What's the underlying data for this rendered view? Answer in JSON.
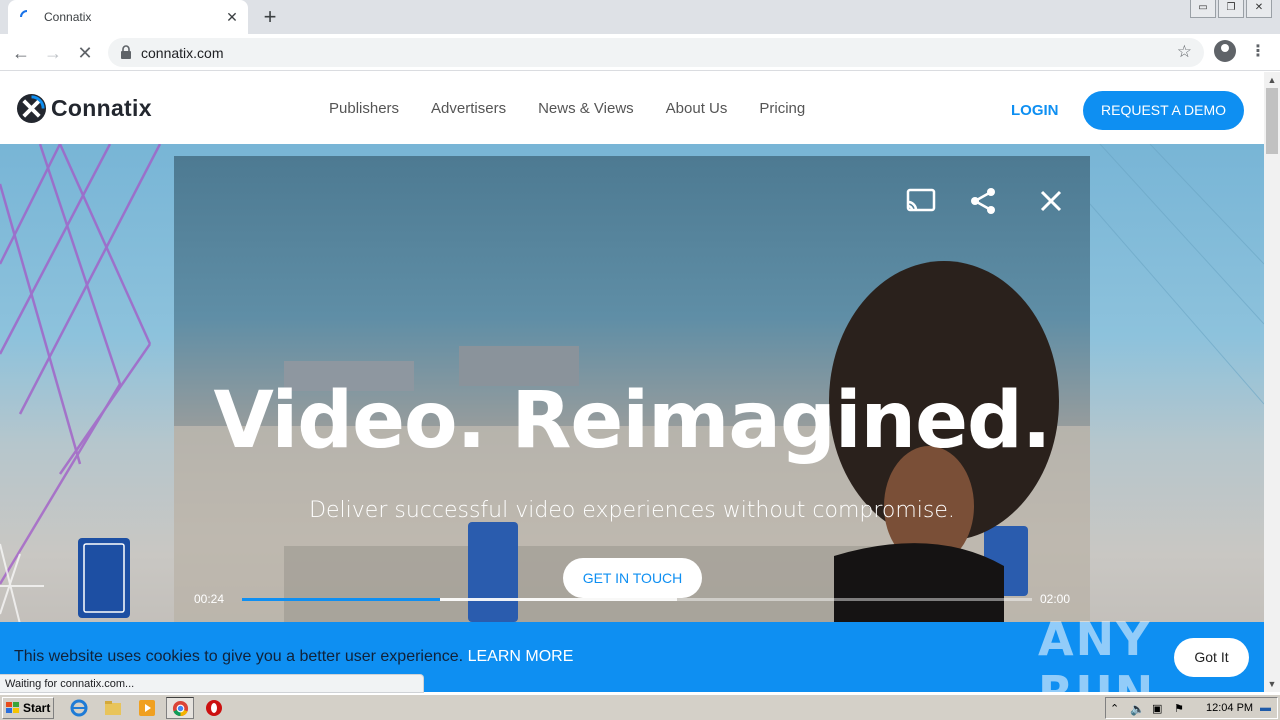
{
  "browser": {
    "tab_title": "Connatix",
    "tab_close": "✕",
    "new_tab": "+",
    "url": "connatix.com",
    "window_buttons": [
      "▭",
      "❐",
      "✕"
    ],
    "status_text": "Waiting for connatix.com..."
  },
  "site": {
    "logo_text": "Connatix",
    "nav": [
      "Publishers",
      "Advertisers",
      "News & Views",
      "About Us",
      "Pricing"
    ],
    "login": "LOGIN",
    "demo_button": "REQUEST A DEMO"
  },
  "hero": {
    "headline": "Video. Reimagined.",
    "subhead": "Deliver successful video experiences without compromise.",
    "cta": "GET IN TOUCH"
  },
  "player": {
    "current_time": "00:24",
    "duration": "02:00",
    "played_fraction": 0.25,
    "buffered_fraction": 0.55
  },
  "cookie": {
    "message": "This website uses cookies to give you a better user experience.",
    "link": "LEARN MORE",
    "button": "Got It"
  },
  "watermark": "ANY RUN",
  "taskbar": {
    "start_label": "Start",
    "clock": "12:04 PM"
  },
  "colors": {
    "brand_blue": "#0e8ff2",
    "logo_dark": "#23272f"
  }
}
